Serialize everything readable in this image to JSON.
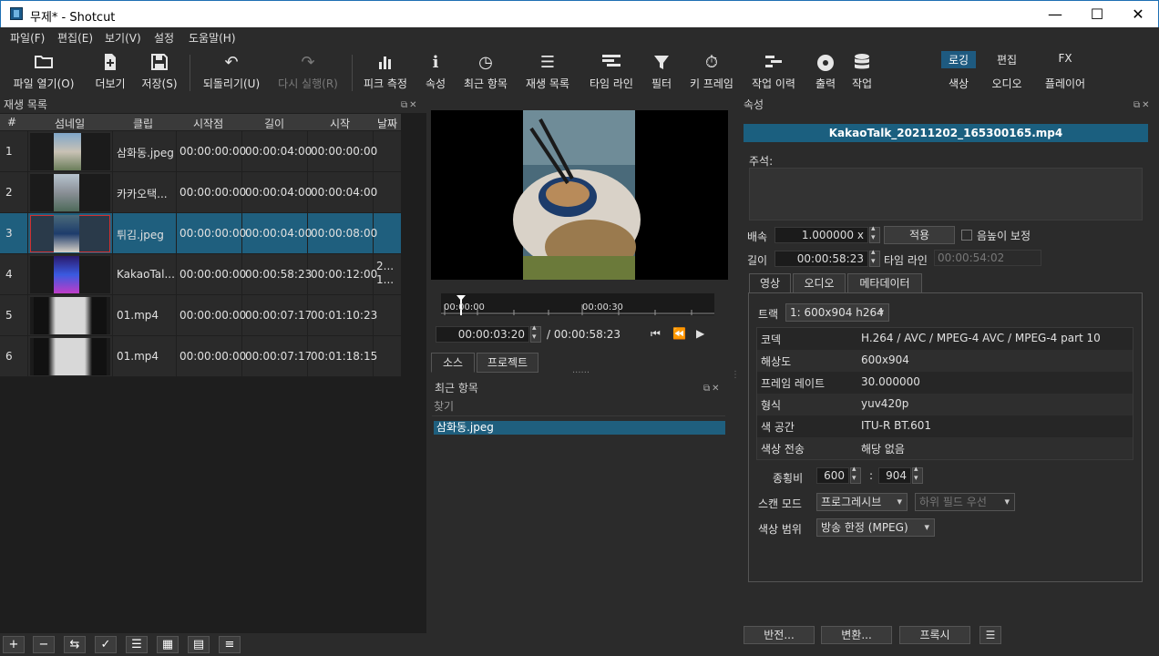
{
  "window": {
    "title": "무제* - Shotcut",
    "minimize": "—",
    "maximize": "☐",
    "close": "✕"
  },
  "menu": [
    "파일(F)",
    "편집(E)",
    "보기(V)",
    "설정",
    "도움말(H)"
  ],
  "toolbar": {
    "open_file": "파일 열기(O)",
    "more": "더보기",
    "save": "저장(S)",
    "undo": "되돌리기(U)",
    "redo": "다시 실행(R)",
    "peak_meter": "피크 측정",
    "properties": "속성",
    "recent": "최근 항목",
    "playlist": "재생 목록",
    "timeline": "타임 라인",
    "filters": "필터",
    "keyframes": "키 프레임",
    "history": "작업 이력",
    "export": "출력",
    "jobs": "작업"
  },
  "layouts": {
    "logging": "로깅",
    "editing": "편집",
    "fx": "FX",
    "color": "색상",
    "audio": "오디오",
    "player": "플레이어"
  },
  "playlist": {
    "title": "재생 목록",
    "columns": [
      "#",
      "섬네일",
      "클립",
      "시작점",
      "길이",
      "시작",
      "날짜"
    ],
    "rows": [
      {
        "num": "1",
        "clip": "삼화동.jpeg",
        "in": "00:00:00:00",
        "duration": "00:00:04:00",
        "start": "00:00:00:00",
        "date": ""
      },
      {
        "num": "2",
        "clip": "카카오택...",
        "in": "00:00:00:00",
        "duration": "00:00:04:00",
        "start": "00:00:04:00",
        "date": ""
      },
      {
        "num": "3",
        "clip": "튀김.jpeg",
        "in": "00:00:00:00",
        "duration": "00:00:04:00",
        "start": "00:00:08:00",
        "date": ""
      },
      {
        "num": "4",
        "clip": "KakaoTal...",
        "in": "00:00:00:00",
        "duration": "00:00:58:23",
        "start": "00:00:12:00",
        "date": "2...\n1..."
      },
      {
        "num": "5",
        "clip": "01.mp4",
        "in": "00:00:00:00",
        "duration": "00:00:07:17",
        "start": "00:01:10:23",
        "date": ""
      },
      {
        "num": "6",
        "clip": "01.mp4",
        "in": "00:00:00:00",
        "duration": "00:00:07:17",
        "start": "00:01:18:15",
        "date": ""
      }
    ],
    "selected_index": 2
  },
  "player": {
    "ruler_start": "00:00:00",
    "ruler_mid": "00:00:30",
    "position": "00:00:03:20",
    "duration": "/ 00:00:58:23",
    "tab_source": "소스",
    "tab_project": "프로젝트"
  },
  "recent": {
    "title": "최근 항목",
    "search_placeholder": "찾기",
    "items": [
      "삼화동.jpeg"
    ]
  },
  "properties": {
    "title": "속성",
    "file_name": "KakaoTalk_20211202_165300165.mp4",
    "comment_label": "주석:",
    "speed_label": "배속",
    "speed_value": "1.000000 x",
    "apply": "적용",
    "pitch_label": "음높이 보정",
    "duration_label": "길이",
    "duration_value": "00:00:58:23",
    "timeline_label": "타임 라인",
    "timeline_value": "00:00:54:02",
    "tabs": [
      "영상",
      "오디오",
      "메타데이터"
    ],
    "track_label": "트랙",
    "track_value": "1: 600x904 h264",
    "info": [
      {
        "k": "코덱",
        "v": "H.264 / AVC / MPEG-4 AVC / MPEG-4 part 10"
      },
      {
        "k": "해상도",
        "v": "600x904"
      },
      {
        "k": "프레임 레이트",
        "v": "30.000000"
      },
      {
        "k": "형식",
        "v": "yuv420p"
      },
      {
        "k": "색 공간",
        "v": "ITU-R BT.601"
      },
      {
        "k": "색상 전송",
        "v": "해당 없음"
      }
    ],
    "aspect_label": "종횡비",
    "aspect_w": "600",
    "aspect_sep": ":",
    "aspect_h": "904",
    "scan_label": "스캔 모드",
    "scan_value": "프로그레시브",
    "field_value": "하위 필드 우선",
    "color_range_label": "색상 범위",
    "color_range_value": "방송 한정 (MPEG)",
    "btn_reverse": "반전...",
    "btn_convert": "변환...",
    "btn_proxy": "프록시",
    "menu_icon": "☰"
  },
  "colors": {
    "accent": "#1f5f7e",
    "title_bar_file": "#1b5f7f"
  }
}
